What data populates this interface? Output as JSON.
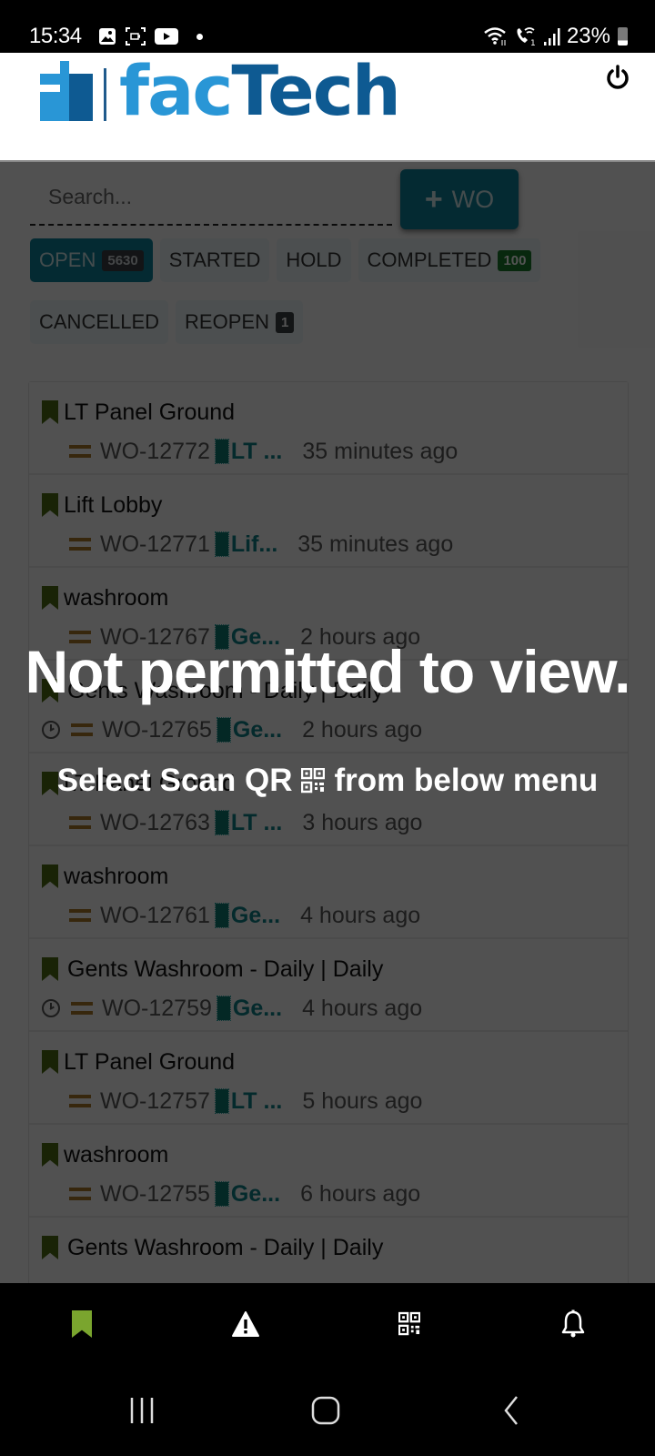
{
  "status_bar": {
    "time": "15:34",
    "notification_icons": [
      "gallery-icon",
      "screen-record-icon",
      "youtube-icon",
      "dot-icon"
    ],
    "system_icons": [
      "wifi-icon",
      "wifi-calling-icon",
      "signal-icon"
    ],
    "battery": "23%"
  },
  "header": {
    "logo_text_part1": "fac",
    "logo_text_part2": "Tech",
    "power_icon": "power-icon"
  },
  "toolbar": {
    "search_placeholder": "Search...",
    "search_value": "",
    "add_button_plus": "+",
    "add_button_label": "WO"
  },
  "filters": [
    {
      "label": "OPEN",
      "badge": "5630",
      "active": true,
      "badge_color": "#3a3f44"
    },
    {
      "label": "STARTED",
      "badge": null,
      "active": false
    },
    {
      "label": "HOLD",
      "badge": null,
      "active": false
    },
    {
      "label": "COMPLETED",
      "badge": "100",
      "active": false,
      "badge_color": "#1a7a2c"
    },
    {
      "label": "CANCELLED",
      "badge": null,
      "active": false
    },
    {
      "label": "REOPEN",
      "badge": "1",
      "active": false,
      "badge_color": "#3c4043"
    }
  ],
  "work_orders": [
    {
      "title": "LT Panel Ground",
      "id": "WO-12772",
      "location": "LT ...",
      "ago": "35 minutes ago",
      "scheduled": false
    },
    {
      "title": "Lift Lobby",
      "id": "WO-12771",
      "location": "Lif...",
      "ago": "35 minutes ago",
      "scheduled": false
    },
    {
      "title": "washroom",
      "id": "WO-12767",
      "location": "Ge...",
      "ago": "2 hours ago",
      "scheduled": false
    },
    {
      "title": "Gents Washroom - Daily | Daily",
      "id": "WO-12765",
      "location": "Ge...",
      "ago": "2 hours ago",
      "scheduled": true
    },
    {
      "title": "LT Panel Ground",
      "id": "WO-12763",
      "location": "LT ...",
      "ago": "3 hours ago",
      "scheduled": false
    },
    {
      "title": "washroom",
      "id": "WO-12761",
      "location": "Ge...",
      "ago": "4 hours ago",
      "scheduled": false
    },
    {
      "title": "Gents Washroom - Daily | Daily",
      "id": "WO-12759",
      "location": "Ge...",
      "ago": "4 hours ago",
      "scheduled": true
    },
    {
      "title": "LT Panel Ground",
      "id": "WO-12757",
      "location": "LT ...",
      "ago": "5 hours ago",
      "scheduled": false
    },
    {
      "title": "washroom",
      "id": "WO-12755",
      "location": "Ge...",
      "ago": "6 hours ago",
      "scheduled": false
    },
    {
      "title": "Gents Washroom - Daily | Daily",
      "id": "",
      "location": "",
      "ago": "",
      "scheduled": false
    }
  ],
  "overlay": {
    "message": "Not permitted to view.",
    "sub_before": "Select Scan QR",
    "sub_after": "from below menu"
  },
  "bottom_nav": [
    {
      "name": "work-orders",
      "icon": "bookmark-icon",
      "active": true,
      "color": "#7aa52e"
    },
    {
      "name": "alerts",
      "icon": "warning-icon",
      "active": false
    },
    {
      "name": "scan-qr",
      "icon": "qr-code-icon",
      "active": false
    },
    {
      "name": "notifications",
      "icon": "bell-icon",
      "active": false
    }
  ],
  "colors": {
    "primary": "#0e7f97",
    "logo_light": "#2996d6",
    "logo_dark": "#0e5a92",
    "bookmark": "#4e6b15",
    "priority": "#a8782a",
    "location": "#0e7f86"
  }
}
